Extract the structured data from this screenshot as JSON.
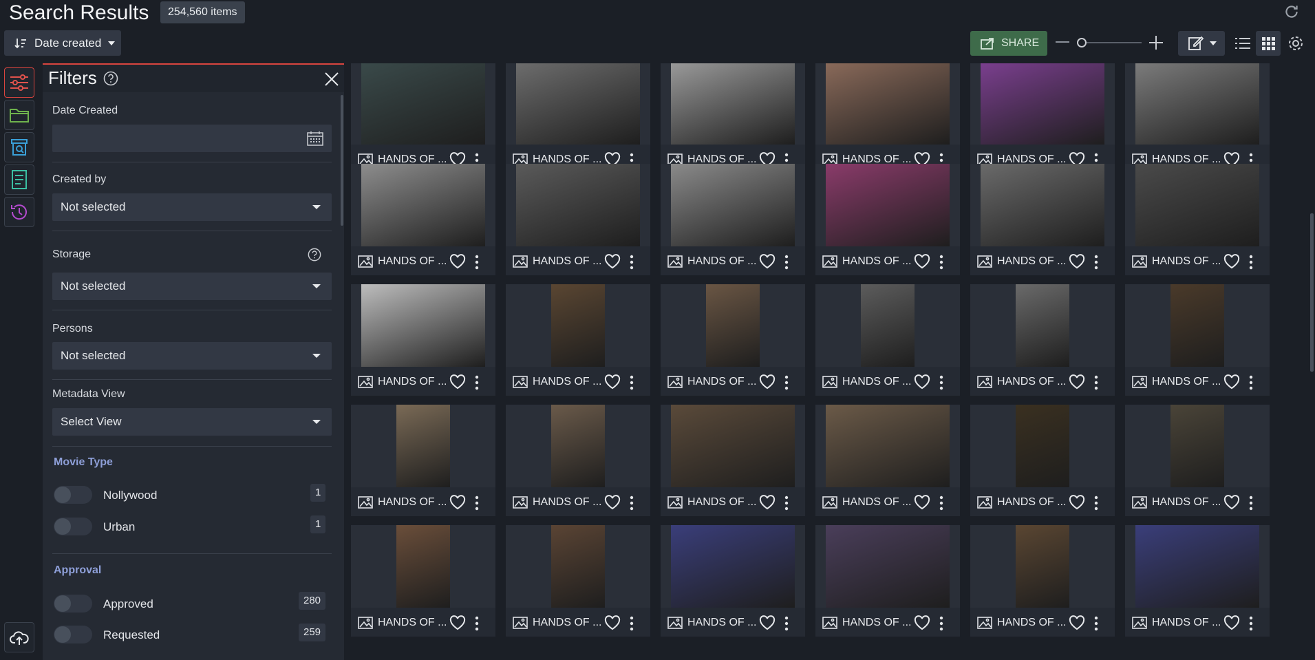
{
  "header": {
    "title": "Search Results",
    "item_count": "254,560 items",
    "sort_label": "Date created"
  },
  "toolbar": {
    "share_label": "SHARE",
    "zoom_level": 0.05
  },
  "filters": {
    "title": "Filters",
    "date_created": {
      "label": "Date Created",
      "value": ""
    },
    "created_by": {
      "label": "Created by",
      "value": "Not selected"
    },
    "storage": {
      "label": "Storage",
      "value": "Not selected"
    },
    "persons": {
      "label": "Persons",
      "value": "Not selected"
    },
    "metadata_view": {
      "label": "Metadata View",
      "value": "Select View"
    },
    "movie_type": {
      "heading": "Movie Type",
      "options": [
        {
          "label": "Nollywood",
          "count": "1"
        },
        {
          "label": "Urban",
          "count": "1"
        }
      ]
    },
    "approval": {
      "heading": "Approval",
      "options": [
        {
          "label": "Approved",
          "count": "280"
        },
        {
          "label": "Requested",
          "count": "259"
        }
      ]
    }
  },
  "colors": {
    "accent_red": "#d9453f",
    "share_green": "#3e6b4a",
    "section_heading": "#8e9fd8"
  },
  "assets": {
    "items": [
      "HANDS OF ...",
      "HANDS OF ...",
      "HANDS OF ...",
      "HANDS OF ...",
      "HANDS OF ...",
      "HANDS OF ...",
      "HANDS OF ...",
      "HANDS OF ...",
      "HANDS OF ...",
      "HANDS OF ...",
      "HANDS OF ...",
      "HANDS OF ...",
      "HANDS OF ...",
      "HANDS OF ...",
      "HANDS OF ...",
      "HANDS OF ...",
      "HANDS OF ...",
      "HANDS OF ...",
      "HANDS OF ...",
      "HANDS OF ...",
      "HANDS OF ...",
      "HANDS OF ...",
      "HANDS OF ...",
      "HANDS OF ...",
      "HANDS OF ...",
      "HANDS OF ...",
      "HANDS OF ...",
      "HANDS OF ...",
      "HANDS OF ...",
      "HANDS OF ..."
    ]
  },
  "icons": [
    "sort-icon",
    "share-icon",
    "zoom-out-icon",
    "zoom-in-icon",
    "edit-icon",
    "list-view-icon",
    "grid-view-icon",
    "settings-icon",
    "refresh-icon",
    "filters-icon",
    "folder-icon",
    "search-archive-icon",
    "document-icon",
    "history-icon",
    "upload-cloud-icon",
    "help-icon",
    "close-icon",
    "calendar-icon",
    "image-icon",
    "heart-icon",
    "more-icon"
  ]
}
